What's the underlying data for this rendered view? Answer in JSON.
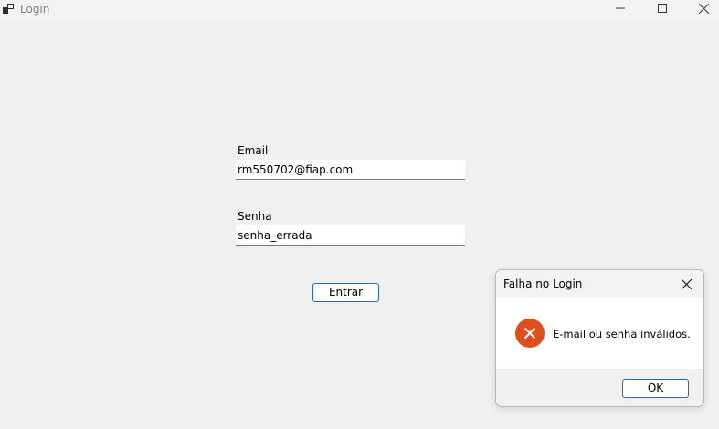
{
  "window": {
    "title": "Login",
    "controls": {
      "minimize_icon": "minimize-icon",
      "maximize_icon": "maximize-icon",
      "close_icon": "close-icon"
    }
  },
  "form": {
    "email_label": "Email",
    "email_value": "rm550702@fiap.com",
    "password_label": "Senha",
    "password_value": "senha_errada",
    "submit_label": "Entrar"
  },
  "dialog": {
    "title": "Falha no Login",
    "icon": "error-icon",
    "message": "E-mail ou senha inválidos.",
    "ok_label": "OK"
  },
  "colors": {
    "window_bg": "#f0f0f0",
    "accent_border": "#1b6cc4",
    "error_icon": "#e04f1a"
  }
}
